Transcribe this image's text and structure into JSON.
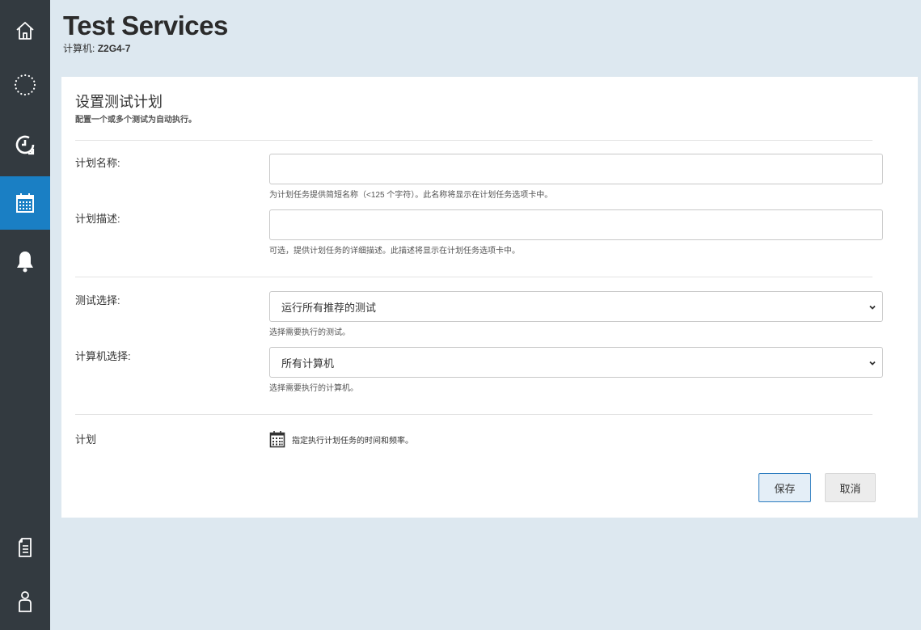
{
  "sidebar": {
    "items": [
      {
        "name": "home",
        "icon": "home-icon"
      },
      {
        "name": "tests",
        "icon": "dotted-circle-icon"
      },
      {
        "name": "history",
        "icon": "clock-history-icon"
      },
      {
        "name": "schedule",
        "icon": "calendar-icon",
        "active": true
      },
      {
        "name": "notifications",
        "icon": "bell-icon"
      },
      {
        "name": "reports",
        "icon": "document-icon"
      },
      {
        "name": "account",
        "icon": "user-icon"
      }
    ],
    "background": "#333a40",
    "active_color": "#1a7fc4"
  },
  "header": {
    "title": "Test Services",
    "machine_label": "计算机:",
    "machine_id": "Z2G4-7"
  },
  "form": {
    "title": "设置测试计划",
    "subtitle": "配置一个或多个测试为自动执行。",
    "plan_name": {
      "label": "计划名称:",
      "value": "",
      "helper": "为计划任务提供简短名称（<125 个字符）。此名称将显示在计划任务选项卡中。"
    },
    "plan_desc": {
      "label": "计划描述:",
      "value": "",
      "helper": "可选，提供计划任务的详细描述。此描述将显示在计划任务选项卡中。"
    },
    "test_select": {
      "label": "测试选择:",
      "value": "运行所有推荐的测试",
      "helper": "选择需要执行的测试。"
    },
    "machine_select": {
      "label": "计算机选择:",
      "value": "所有计算机",
      "helper": "选择需要执行的计算机。"
    },
    "schedule": {
      "label": "计划",
      "link": "指定执行计划任务的时间和频率。"
    },
    "save_label": "保存",
    "cancel_label": "取消"
  }
}
